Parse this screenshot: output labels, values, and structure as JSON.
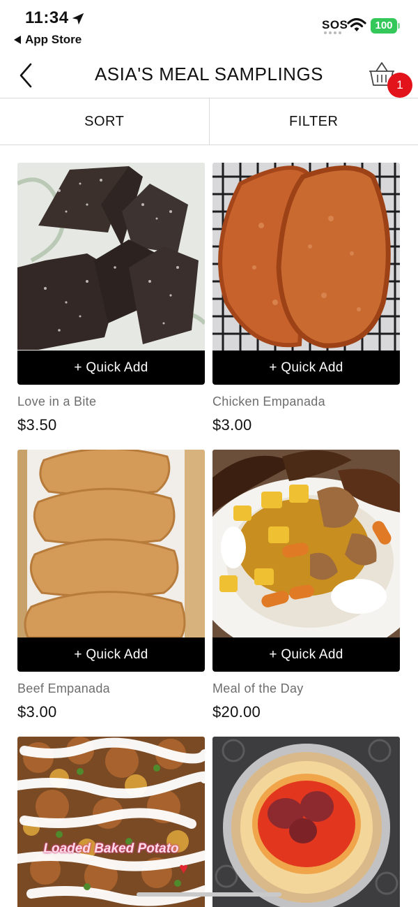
{
  "status_bar": {
    "time": "11:34",
    "back_app_label": "App Store",
    "sos": "SOS",
    "battery": "100"
  },
  "header": {
    "title": "ASIA'S MEAL SAMPLINGS",
    "cart_count": "1"
  },
  "toolbar": {
    "sort_label": "SORT",
    "filter_label": "FILTER"
  },
  "products": [
    {
      "name": "Love in a Bite",
      "price": "$3.50",
      "quick_add": "+ Quick Add"
    },
    {
      "name": "Chicken Empanada",
      "price": "$3.00",
      "quick_add": "+ Quick Add"
    },
    {
      "name": "Beef Empanada",
      "price": "$3.00",
      "quick_add": "+ Quick Add"
    },
    {
      "name": "Meal of the Day",
      "price": "$20.00",
      "quick_add": "+ Quick Add"
    },
    {
      "name": "",
      "price": "",
      "image_caption": "Loaded Baked Potato"
    },
    {
      "name": "",
      "price": ""
    }
  ],
  "colors": {
    "accent": "#000000",
    "badge": "#e3131c",
    "battery": "#34c759",
    "muted_text": "#6d6d6d"
  }
}
